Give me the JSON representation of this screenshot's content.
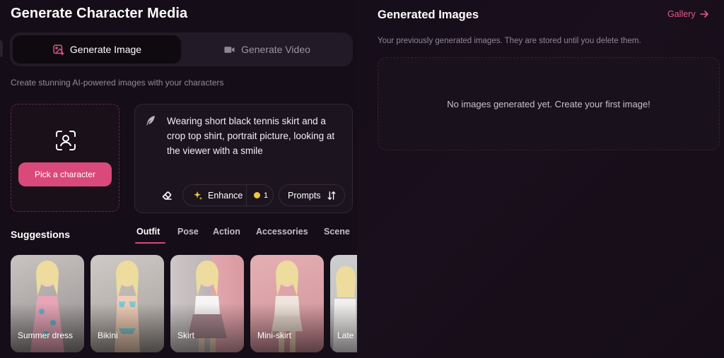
{
  "header": {
    "title": "Generate Character Media"
  },
  "media_tabs": [
    {
      "label": "Generate Image",
      "active": true
    },
    {
      "label": "Generate Video",
      "active": false
    }
  ],
  "subtitle": "Create stunning AI-powered images with your characters",
  "character_picker": {
    "button_label": "Pick a character"
  },
  "prompt": {
    "value": "Wearing short black tennis skirt and a crop top shirt, portrait picture, looking at the viewer with a smile",
    "enhance_label": "Enhance",
    "enhance_cost": "1",
    "prompts_label": "Prompts"
  },
  "suggestions": {
    "title": "Suggestions",
    "tabs": [
      "Outfit",
      "Pose",
      "Action",
      "Accessories",
      "Scene"
    ],
    "active_tab": "Outfit",
    "items": [
      {
        "label": "Summer dress"
      },
      {
        "label": "Bikini"
      },
      {
        "label": "Skirt"
      },
      {
        "label": "Mini-skirt"
      },
      {
        "label": "Late"
      }
    ]
  },
  "generated": {
    "title": "Generated Images",
    "gallery_label": "Gallery",
    "description": "Your previously generated images. They are stored until you delete them.",
    "empty_message": "No images generated yet. Create your first image!"
  },
  "colors": {
    "accent": "#d9497a",
    "background": "#120a15",
    "panel": "#1c151f",
    "coin": "#f4c542"
  }
}
